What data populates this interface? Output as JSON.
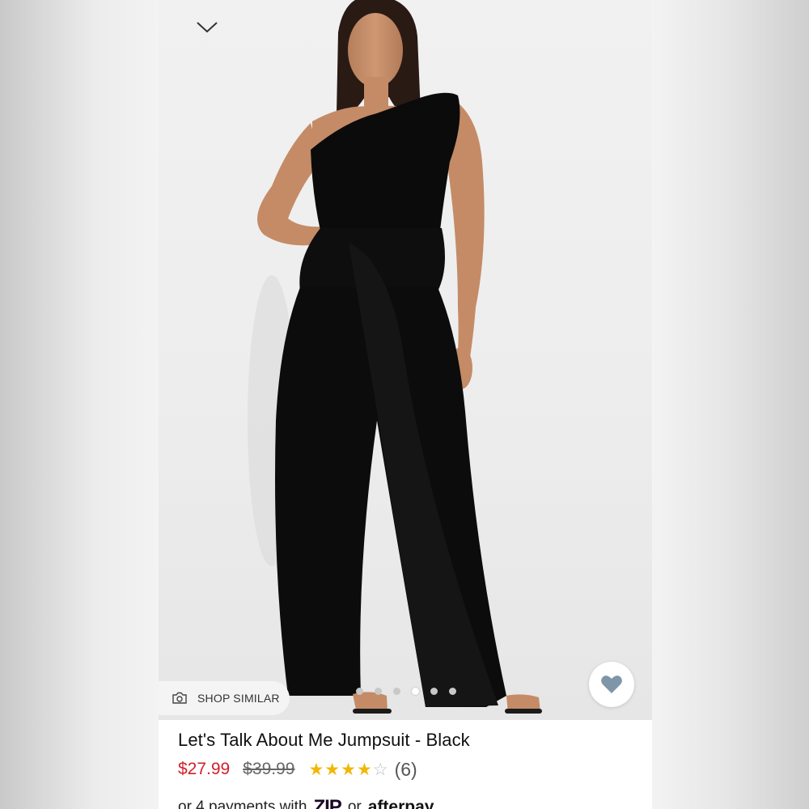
{
  "product": {
    "title": "Let's Talk About Me Jumpsuit - Black",
    "sale_price": "$27.99",
    "original_price": "$39.99",
    "rating": 4.5,
    "rating_max": 5,
    "review_count": "(6)"
  },
  "gallery": {
    "shop_similar_label": "SHOP SIMILAR",
    "image_count": 6,
    "active_index": 3
  },
  "payment": {
    "prefix": "or 4 payments with",
    "zip_logo": "ZIP",
    "connector": "or",
    "afterpay_logo": "afterpay"
  },
  "icons": {
    "collapse": "chevron-down-icon",
    "camera": "camera-icon",
    "favorite": "heart-icon"
  },
  "colors": {
    "sale_price": "#d0202c",
    "star": "#f2b705",
    "heart": "#7f95a8"
  }
}
